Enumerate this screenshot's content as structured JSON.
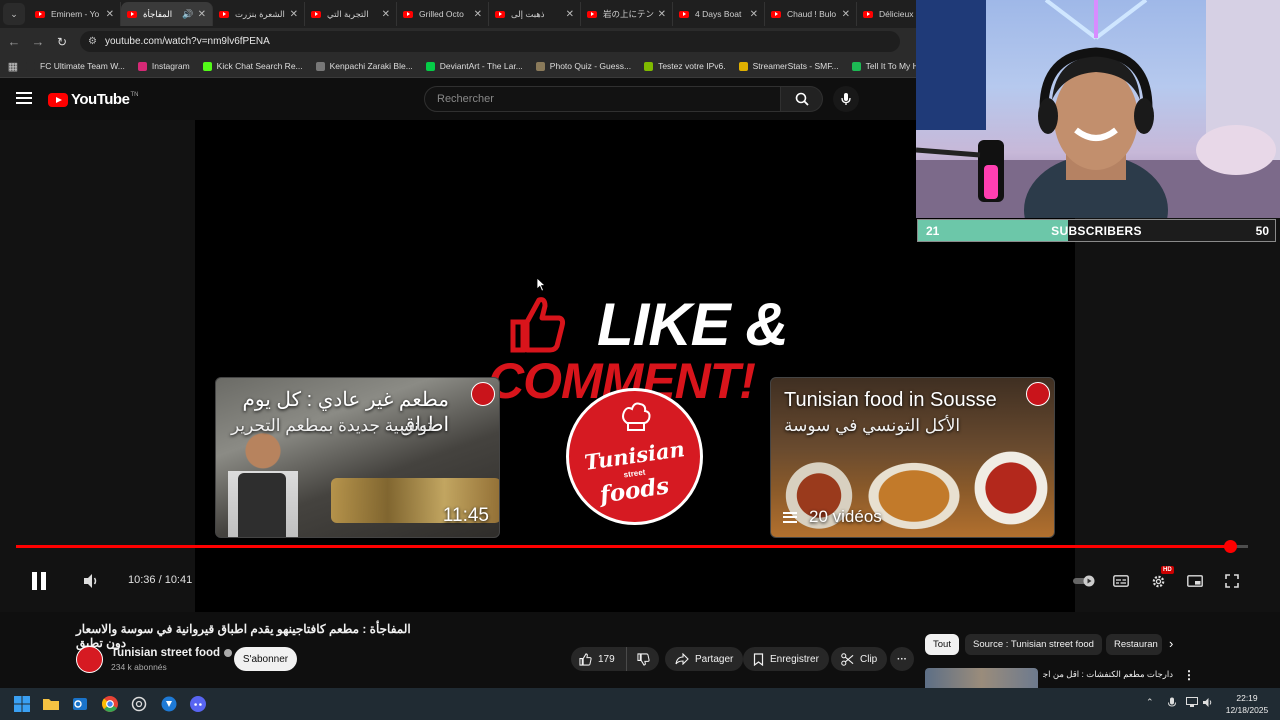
{
  "browser": {
    "tabs": [
      {
        "label": "Eminem - Yo",
        "active": false
      },
      {
        "label": "المفاجأة",
        "active": true,
        "audio": true
      },
      {
        "label": "الشعرة بنزرت",
        "active": false
      },
      {
        "label": "التجربة التي",
        "active": false
      },
      {
        "label": "Grilled Octo",
        "active": false
      },
      {
        "label": "ذهبت إلى",
        "active": false
      },
      {
        "label": "岩の上にテン",
        "active": false
      },
      {
        "label": "4 Days Boat",
        "active": false
      },
      {
        "label": "Chaud ! Bulo",
        "active": false
      },
      {
        "label": "Délicieux p",
        "active": false
      }
    ],
    "url": "youtube.com/watch?v=nm9lv6fPENA",
    "bookmarks": [
      {
        "label": "FC Ultimate Team W...",
        "color": "#2b2b2b"
      },
      {
        "label": "Instagram",
        "color": "#d62976"
      },
      {
        "label": "Kick Chat Search Re...",
        "color": "#53fc18"
      },
      {
        "label": "Kenpachi Zaraki Ble...",
        "color": "#777777"
      },
      {
        "label": "DeviantArt - The Lar...",
        "color": "#05cc47"
      },
      {
        "label": "Photo Quiz - Guess...",
        "color": "#8a7a5a"
      },
      {
        "label": "Testez votre IPv6.",
        "color": "#7fba00"
      },
      {
        "label": "StreamerStats - SMF...",
        "color": "#e0b000"
      },
      {
        "label": "Tell It To My Heart -...",
        "color": "#1db954"
      }
    ]
  },
  "youtube": {
    "logo_text": "YouTube",
    "logo_tm": "TN",
    "search_placeholder": "Rechercher"
  },
  "player": {
    "overlay_like": "LIKE &",
    "overlay_comment": "COMMENT!",
    "endcard_left": {
      "title": "مطعم غير عادي : كل يوم اطباق",
      "subtitle": "تونسية جديدة بمطعم التحرير",
      "duration": "11:45"
    },
    "endcard_right": {
      "title": "Tunisian food in Sousse",
      "subtitle": "الأكل التونسي في سوسة",
      "playlist_count": "20 vidéos"
    },
    "center_logo": {
      "line1": "Tunisian",
      "line2": "street",
      "line3": "foods"
    },
    "time_display": "10:36 / 10:41",
    "progress_fraction": 0.985,
    "hd_badge": "HD"
  },
  "webcam": {
    "subs_current": "21",
    "subs_label": "SUBSCRIBERS",
    "subs_goal": "50",
    "subs_fraction": 0.42
  },
  "video_info": {
    "title": "المفاجأة : مطعم كافتاجينهو يقدم اطباق قيروانية في سوسة والاسعار دون تطبق",
    "channel_name": "Tunisian street food",
    "subscribers": "234 k abonnés",
    "subscribe_label": "S'abonner",
    "like_count": "179",
    "share_label": "Partager",
    "save_label": "Enregistrer",
    "clip_label": "Clip",
    "more_label": "···"
  },
  "recommendations": {
    "chips": [
      "Tout",
      "Source : Tunisian street food",
      "Restauran"
    ],
    "first_title": "دارجات مطعم الكنفشات : اقل من اجل"
  },
  "taskbar": {
    "time": "22:19",
    "date": "12/18/2025"
  }
}
